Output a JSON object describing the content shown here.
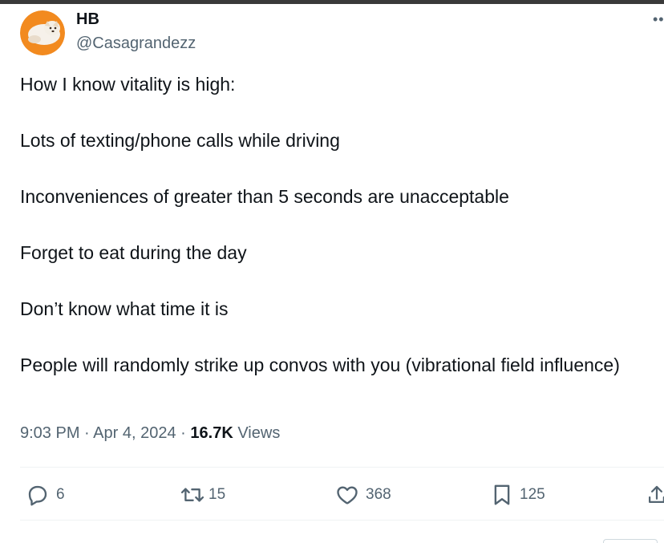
{
  "tweet": {
    "author": {
      "display_name": "HB",
      "handle": "@Casagrandezz"
    },
    "text_lines": [
      "How I know vitality is high:",
      "Lots of texting/phone calls while driving",
      "Inconveniences of greater than 5 seconds are unacceptable",
      "Forget to eat during the day",
      "Don’t know what time it is",
      "People will randomly strike up convos with you (vibrational field influence)"
    ],
    "meta": {
      "time": "9:03 PM",
      "separator": "·",
      "date": "Apr 4, 2024",
      "views_count": "16.7K",
      "views_label": "Views"
    },
    "actions": {
      "replies": "6",
      "reposts": "15",
      "likes": "368",
      "bookmarks": "125"
    }
  },
  "icons": {
    "more": "more-icon",
    "reply": "reply-icon",
    "repost": "repost-icon",
    "like": "heart-icon",
    "bookmark": "bookmark-icon",
    "share": "share-icon"
  },
  "colors": {
    "text": "#0f1419",
    "secondary": "#536471",
    "divider": "#eff3f4",
    "avatar_bg": "#f28a1f"
  }
}
